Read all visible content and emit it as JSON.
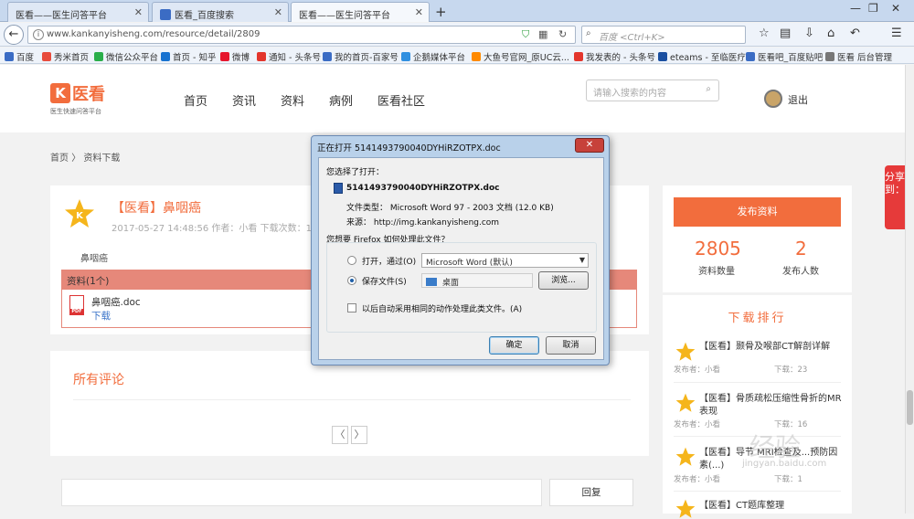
{
  "tabs": [
    {
      "label": "医看——医生问答平台"
    },
    {
      "label": "医看_百度搜索"
    },
    {
      "label": "医看——医生问答平台"
    }
  ],
  "url": "www.kankanyisheng.com/resource/detail/2809",
  "browser_search": {
    "placeholder": "百度 <Ctrl+K>"
  },
  "bookmarks": [
    "百度",
    "秀米首页",
    "微信公众平台",
    "首页 - 知乎",
    "微博",
    "通知 - 头条号",
    "我的首页-百家号",
    "企鹅媒体平台",
    "大鱼号官网_原UC云...",
    "我发表的 - 头条号",
    "eteams - 至临医疗",
    "医看吧_百度贴吧",
    "医看 后台管理"
  ],
  "site": {
    "logo_name": "医看",
    "logo_tag": "医生快速问答平台",
    "nav": [
      "首页",
      "资讯",
      "资料",
      "病例",
      "医看社区"
    ],
    "search_placeholder": "请输入搜索的内容",
    "logout": "退出"
  },
  "breadcrumb": {
    "home": "首页",
    "sep": "〉",
    "current": "资料下载"
  },
  "resource": {
    "title": "【医看】鼻咽癌",
    "meta": "2017-05-27 14:48:56  作者：小看  下载次数：1",
    "tag": "鼻咽癌",
    "section": "资料(1个)",
    "file_name": "鼻咽癌.doc",
    "download": "下载",
    "pdf_label": "PDF"
  },
  "comments": {
    "title": "所有评论",
    "prev": "〈",
    "next": "〉",
    "reply": "回复"
  },
  "sidebar": {
    "publish": "发布资料",
    "stats": [
      {
        "num": "2805",
        "label": "资料数量"
      },
      {
        "num": "2",
        "label": "发布人数"
      }
    ],
    "rank_title": "下载排行",
    "rank": [
      {
        "title": "【医看】颞骨及喉部CT解剖详解",
        "author": "发布者：小看",
        "count": "下载：23"
      },
      {
        "title": "【医看】骨质疏松压缩性骨折的MR表现",
        "author": "发布者：小看",
        "count": "下载：16"
      },
      {
        "title": "【医看】导节 MRI检查及...预防因素(...)",
        "author": "发布者：小看",
        "count": "下载：1"
      },
      {
        "title": "【医看】CT题库整理",
        "author": "",
        "count": ""
      }
    ]
  },
  "share": "分享到：",
  "watermark": "经验",
  "watermark_url": "jingyan.baidu.com",
  "dialog": {
    "title": "正在打开 5141493790040DYHiRZOTPX.doc",
    "close": "✕",
    "chosen": "您选择了打开：",
    "file": "5141493790040DYHiRZOTPX.doc",
    "type": "文件类型：  Microsoft Word 97 - 2003 文档 (12.0 KB)",
    "source": "来源：  http://img.kankanyisheng.com",
    "question": "您想要 Firefox 如何处理此文件？",
    "open_with": "打开，通过(O)",
    "open_app": "Microsoft Word (默认)",
    "save": "保存文件(S)",
    "save_target": "桌面",
    "browse": "浏览...",
    "auto": "以后自动采用相同的动作处理此类文件。(A)",
    "ok": "确定",
    "cancel": "取消"
  },
  "colors": {
    "brand": "#f26d3d",
    "bar": "#e6887a"
  }
}
